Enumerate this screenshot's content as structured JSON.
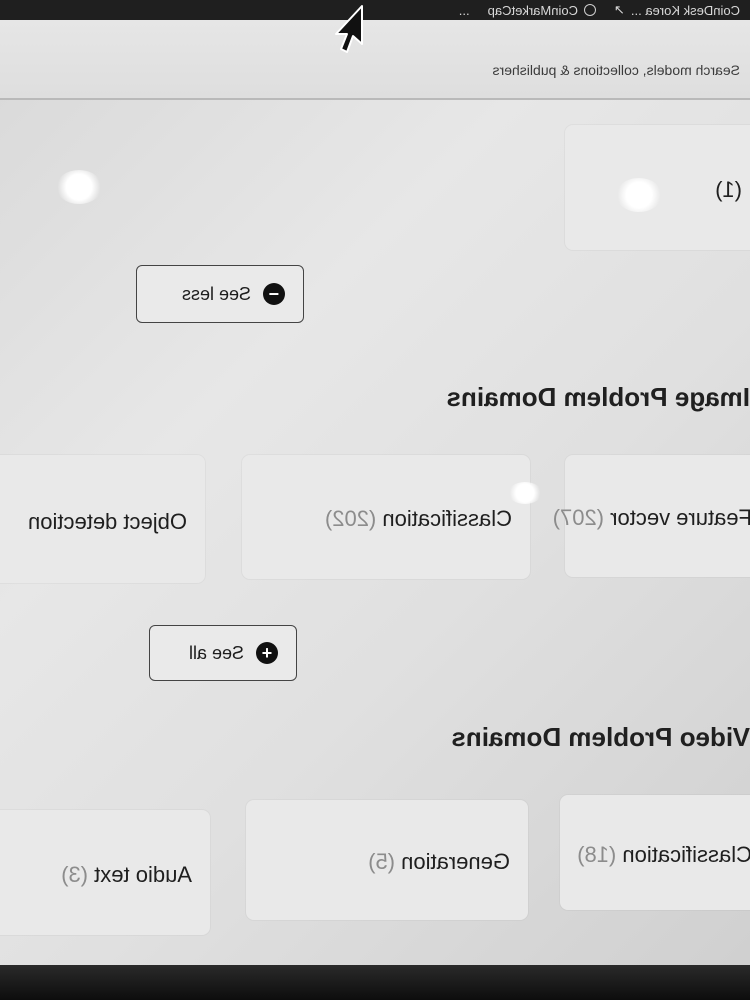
{
  "browser": {
    "tabs": [
      {
        "label": "CoinDesk Korea ...",
        "icon": "external-link-icon"
      },
      {
        "label": "CoinMarketCap",
        "icon": "circle-icon"
      },
      {
        "label": "...",
        "icon": "truncated"
      }
    ]
  },
  "search": {
    "placeholder": "Search models, collections & publishers"
  },
  "top_card": {
    "count": "(1)"
  },
  "image_section": {
    "title": "Image Problem Domains",
    "see_less_label": "See less",
    "items": [
      {
        "label": "Feature vector",
        "count": "(207)"
      },
      {
        "label": "Classification",
        "count": "(202)"
      },
      {
        "label": "Object detection",
        "count": ""
      }
    ],
    "see_all_label": "See all"
  },
  "video_section": {
    "title": "Video Problem Domains",
    "items": [
      {
        "label": "Classification",
        "count": "(18)"
      },
      {
        "label": "Generation",
        "count": "(5)"
      },
      {
        "label": "Audio text",
        "count": "(3)"
      }
    ]
  },
  "colors": {
    "screen_bg": "#e3e3e3",
    "card_bg": "#e9e9e9",
    "text_dark": "#1f1f1f",
    "count_gray": "#8c8c8c",
    "topbar": "#1f1f1f"
  }
}
